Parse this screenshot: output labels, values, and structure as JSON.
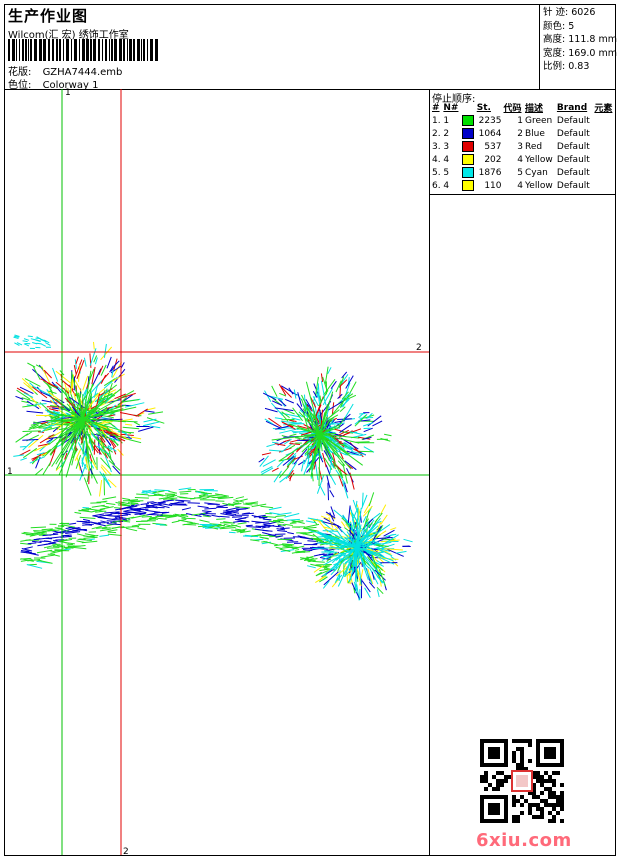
{
  "header": {
    "title": "生产作业图",
    "subtitle": "Wilcom(汇 宏) 绣饰工作室",
    "design_label": "花版:",
    "design_value": "GZHA7444.emb",
    "colorway_label": "色位:",
    "colorway_value": "Colorway 1"
  },
  "stats": [
    {
      "label": "针 迹:",
      "value": "6026"
    },
    {
      "label": "颜色:",
      "value": "5"
    },
    {
      "label": "高度:",
      "value": "111.8 mm"
    },
    {
      "label": "宽度:",
      "value": "169.0 mm"
    },
    {
      "label": "比例:",
      "value": "0.83"
    }
  ],
  "stop_sequence": {
    "title": "停止顺序:",
    "columns": [
      "#",
      "N#",
      "St.",
      "代码",
      "描述",
      "Brand",
      "元素"
    ],
    "rows": [
      {
        "idx": "1.",
        "n": "1",
        "color": "#00e000",
        "st": "2235",
        "code": "1",
        "desc": "Green",
        "brand": "Default"
      },
      {
        "idx": "2.",
        "n": "2",
        "color": "#0000c8",
        "st": "1064",
        "code": "2",
        "desc": "Blue",
        "brand": "Default"
      },
      {
        "idx": "3.",
        "n": "3",
        "color": "#e00000",
        "st": "537",
        "code": "3",
        "desc": "Red",
        "brand": "Default"
      },
      {
        "idx": "4.",
        "n": "4",
        "color": "#ffff00",
        "st": "202",
        "code": "4",
        "desc": "Yellow",
        "brand": "Default"
      },
      {
        "idx": "5.",
        "n": "5",
        "color": "#00e8e8",
        "st": "1876",
        "code": "5",
        "desc": "Cyan",
        "brand": "Default"
      },
      {
        "idx": "6.",
        "n": "4",
        "color": "#ffff00",
        "st": "110",
        "code": "4",
        "desc": "Yellow",
        "brand": "Default"
      }
    ]
  },
  "canvas": {
    "axis_v1": "1",
    "axis_h2": "2",
    "axis_h1": "1",
    "axis_v2": "2",
    "guide_green": "#00c000",
    "guide_red": "#e00000"
  },
  "watermark": "6xiu.com"
}
